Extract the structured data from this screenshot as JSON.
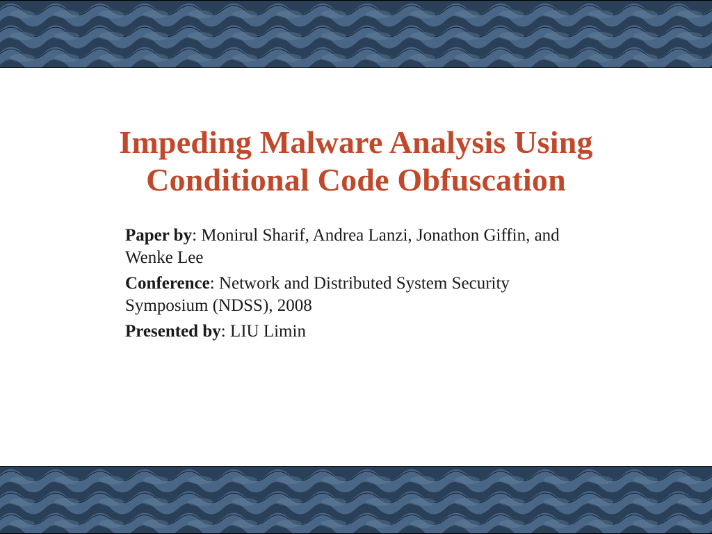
{
  "title": "Impeding Malware Analysis Using Conditional Code Obfuscation",
  "paper_by_label": "Paper by",
  "paper_by_value": ": Monirul Sharif, Andrea Lanzi, Jonathon Giffin, and Wenke Lee",
  "conference_label": "Conference",
  "conference_value": ": Network and Distributed System Security Symposium (NDSS), 2008",
  "presented_by_label": "Presented by",
  "presented_by_value": ": LIU Limin",
  "colors": {
    "title": "#c0492b",
    "band_dark": "#2a3f58",
    "band_mid": "#3e5a7a",
    "band_light": "#5a7896"
  }
}
